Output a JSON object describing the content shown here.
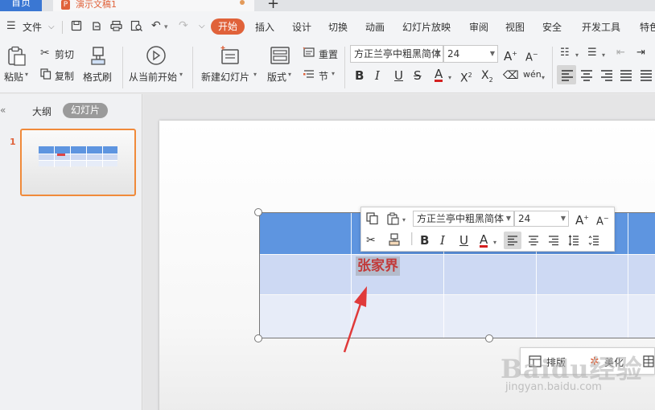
{
  "titlebar": {
    "home_tab": "首页",
    "doc_logo": "P",
    "doc_name": "演示文稿1",
    "new_tab": "+"
  },
  "menubar": {
    "file_menu": "文件",
    "items": [
      "开始",
      "插入",
      "设计",
      "切换",
      "动画",
      "幻灯片放映",
      "审阅",
      "视图",
      "安全",
      "开发工具",
      "特色"
    ]
  },
  "ribbon": {
    "paste": "粘贴",
    "cut": "剪切",
    "copy": "复制",
    "format_painter": "格式刷",
    "play_from_current": "从当前开始",
    "new_slide": "新建幻灯片",
    "layout": "版式",
    "reset": "重置",
    "section": "节",
    "font_name": "方正兰亭中粗黑简体",
    "font_size": "24"
  },
  "left_panel": {
    "outline_tab": "大纲",
    "slides_tab": "幻灯片",
    "slide_number": "1"
  },
  "slide": {
    "cell_text": "张家界"
  },
  "mini_toolbar": {
    "font_name": "方正兰亭中粗黑简体",
    "font_size": "24"
  },
  "quick_bar": {
    "layout_label": "排版",
    "beautify_label": "美化"
  },
  "watermark": {
    "brand": "Baidu经验",
    "url": "jingyan.baidu.com"
  },
  "colors": {
    "accent": "#e0623a",
    "table_header": "#5e95e0",
    "table_row1": "#cdd9f3",
    "table_row2": "#e7ecf8",
    "cell_text": "#c23a3a",
    "arrow": "#e03a3a",
    "home_tab": "#3a77d3"
  }
}
